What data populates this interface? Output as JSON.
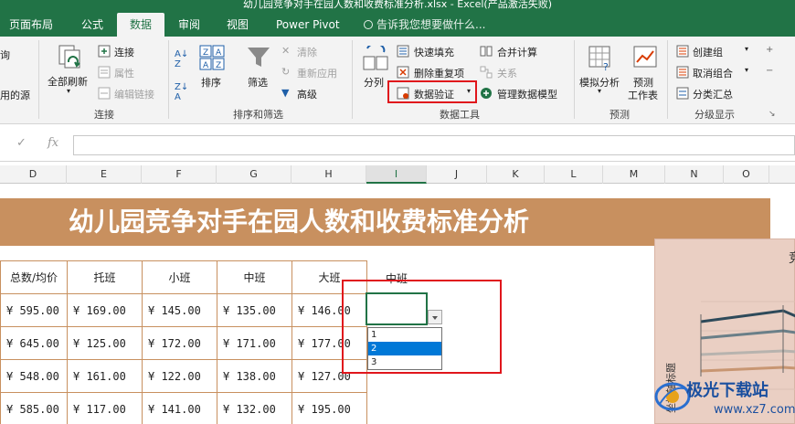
{
  "window": {
    "title": "幼儿园竞争对手在园人数和收费标准分析.xlsx - Excel(产品激活失败)"
  },
  "tabs": [
    {
      "label": "页面布局",
      "active": false
    },
    {
      "label": "公式",
      "active": false
    },
    {
      "label": "数据",
      "active": true
    },
    {
      "label": "审阅",
      "active": false
    },
    {
      "label": "视图",
      "active": false
    },
    {
      "label": "Power Pivot",
      "active": false
    }
  ],
  "tell_me": "告诉我您想要做什么...",
  "ribbon": {
    "left_partial": {
      "top": "询",
      "bottom": "用的源"
    },
    "connections": {
      "refresh_all": "全部刷新",
      "connections": "连接",
      "properties": "属性",
      "edit_links": "编辑链接",
      "label": "连接"
    },
    "sort_filter": {
      "sort": "排序",
      "filter": "筛选",
      "clear": "清除",
      "reapply": "重新应用",
      "advanced": "高级",
      "label": "排序和筛选"
    },
    "data_tools": {
      "text_to_columns": "分列",
      "flash_fill": "快速填充",
      "remove_duplicates": "删除重复项",
      "data_validation": "数据验证",
      "consolidate": "合并计算",
      "relationships": "关系",
      "manage_data_model": "管理数据模型",
      "label": "数据工具"
    },
    "forecast": {
      "what_if": "模拟分析",
      "forecast_sheet_1": "预测",
      "forecast_sheet_2": "工作表",
      "label": "预测"
    },
    "outline": {
      "group": "创建组",
      "ungroup": "取消组合",
      "subtotal": "分类汇总",
      "label": "分级显示"
    }
  },
  "formula_bar": {
    "fx": "fx",
    "value": ""
  },
  "columns": [
    "D",
    "E",
    "F",
    "G",
    "H",
    "I",
    "J",
    "K",
    "L",
    "M",
    "N",
    "O"
  ],
  "sheet": {
    "banner": "幼儿园竞争对手在园人数和收费标准分析",
    "headers": [
      "总数/均价",
      "托班",
      "小班",
      "中班",
      "大班"
    ],
    "rows": [
      [
        "¥ 595.00",
        "¥  169.00",
        "¥  145.00",
        "¥  135.00",
        "¥  146.00"
      ],
      [
        "¥ 645.00",
        "¥  125.00",
        "¥  172.00",
        "¥  171.00",
        "¥  177.00"
      ],
      [
        "¥ 548.00",
        "¥  161.00",
        "¥  122.00",
        "¥  138.00",
        "¥  127.00"
      ],
      [
        "¥ 585.00",
        "¥  117.00",
        "¥  141.00",
        "¥  132.00",
        "¥  195.00"
      ]
    ],
    "i_header": "中班",
    "dropdown": {
      "options": [
        "1",
        "2",
        "3"
      ],
      "selected": "2"
    },
    "chart_title_partial": "竞",
    "chart_ylabel": "坐标轴标题"
  },
  "watermark": {
    "brand": "极光下载站",
    "url": "www.xz7.com"
  },
  "colors": {
    "excel_green": "#217346",
    "banner": "#c8905f",
    "highlight_red": "#e0161c",
    "selection_blue": "#0078d7"
  }
}
